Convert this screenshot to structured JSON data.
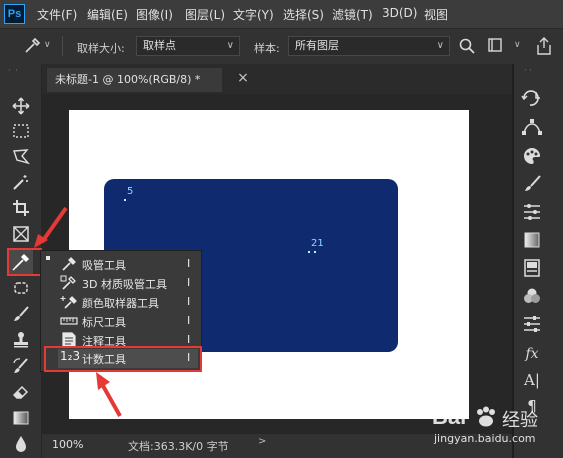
{
  "menubar": {
    "logo": "Ps",
    "items": [
      "文件(F)",
      "编辑(E)",
      "图像(I)",
      "图层(L)",
      "文字(Y)",
      "选择(S)",
      "滤镜(T)",
      "3D(D)",
      "视图"
    ]
  },
  "options": {
    "sample_size_label": "取样大小:",
    "sample_size_value": "取样点",
    "sample_label": "样本:",
    "sample_value": "所有图层"
  },
  "document": {
    "tab_title": "未标题-1 @ 100%(RGB/8) *",
    "close_glyph": "×",
    "markers": [
      "5",
      "21"
    ]
  },
  "statusbar": {
    "zoom": "100%",
    "info": "文档:363.3K/0 字节",
    "arrow": ">"
  },
  "flyout": {
    "items": [
      {
        "label": "吸管工具",
        "key": "I"
      },
      {
        "label": "3D 材质吸管工具",
        "key": "I"
      },
      {
        "label": "颜色取样器工具",
        "key": "I"
      },
      {
        "label": "标尺工具",
        "key": "I"
      },
      {
        "label": "注释工具",
        "key": "I"
      },
      {
        "label": "计数工具",
        "key": "I"
      }
    ],
    "count_icon_text": "1₂3"
  },
  "right_panel": {
    "fx_label": "fx",
    "type_label": "A|",
    "para_label": "¶"
  },
  "watermark": {
    "brand": "Bai",
    "brand_suffix": "经验",
    "url": "jingyan.baidu.com"
  },
  "colors": {
    "accent_red": "#e53935",
    "canvas_rect": "#0f2a6e",
    "ps_blue": "#2fa3f7"
  },
  "icons": [
    "move-icon",
    "marquee-icon",
    "lasso-icon",
    "magic-wand-icon",
    "crop-icon",
    "frame-icon",
    "eyedropper-icon",
    "patch-icon",
    "brush-icon",
    "stamp-icon",
    "history-brush-icon",
    "eraser-icon",
    "gradient-icon",
    "blur-icon"
  ]
}
